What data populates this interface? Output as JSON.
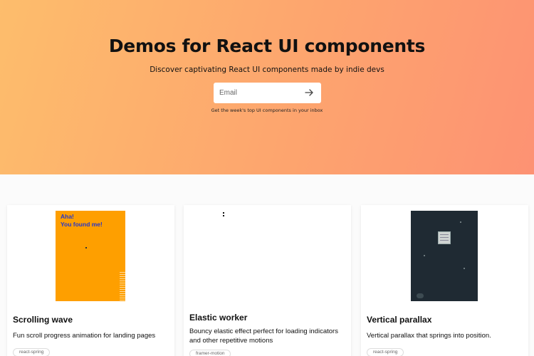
{
  "hero": {
    "title": "Demos for React UI components",
    "subtitle": "Discover captivating React UI components made by indie devs",
    "email_placeholder": "Email",
    "submit_icon": "arrow-right-icon",
    "note": "Get the week's top UI components in your inbox"
  },
  "colors": {
    "hero_gradient_start": "#fdbd6c",
    "hero_gradient_end": "#fd9273",
    "orange_preview": "#fe9f00",
    "aha_text": "#2637c9",
    "dark_preview": "#1f2a33"
  },
  "cards": [
    {
      "title": "Scrolling wave",
      "description": "Fun scroll progress animation for landing pages",
      "tag": "react-spring",
      "preview_text": [
        "Aha!",
        "You found me!"
      ]
    },
    {
      "title": "Elastic worker",
      "description": "Bouncy elastic effect perfect for loading indicators and other repetitive motions",
      "tag": "framer-motion"
    },
    {
      "title": "Vertical parallax",
      "description": "Vertical parallax that springs into position.",
      "tag": "react-spring"
    }
  ]
}
